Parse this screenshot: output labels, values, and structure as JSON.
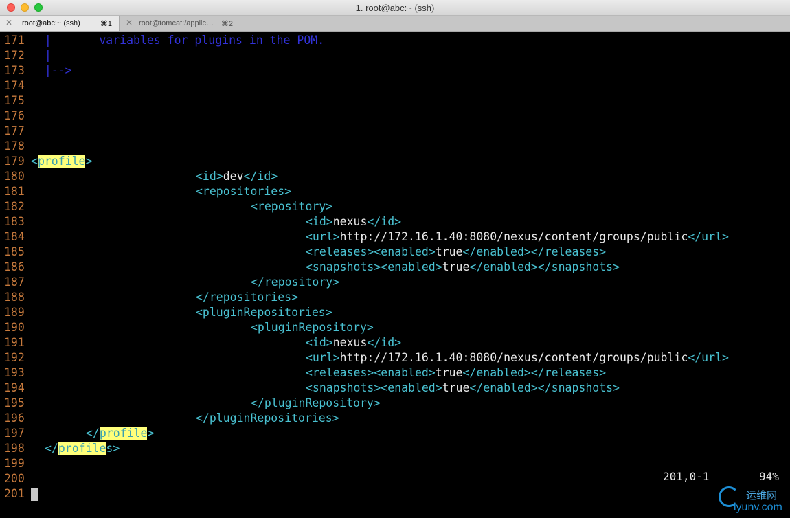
{
  "window": {
    "title": "1. root@abc:~ (ssh)"
  },
  "tabs": [
    {
      "label": "root@abc:~ (ssh)",
      "shortcut": "⌘1"
    },
    {
      "label": "root@tomcat:/applic…",
      "shortcut": "⌘2"
    }
  ],
  "lines": [
    {
      "n": "171",
      "indent": 0,
      "segments": [
        {
          "t": "  |       variables for plugins in the POM.",
          "c": "comment"
        }
      ]
    },
    {
      "n": "172",
      "indent": 0,
      "segments": [
        {
          "t": "  |",
          "c": "comment"
        }
      ]
    },
    {
      "n": "173",
      "indent": 0,
      "segments": [
        {
          "t": "  |-->",
          "c": "comment"
        }
      ]
    },
    {
      "n": "174",
      "indent": 0,
      "segments": []
    },
    {
      "n": "175",
      "indent": 0,
      "segments": []
    },
    {
      "n": "176",
      "indent": 0,
      "segments": []
    },
    {
      "n": "177",
      "indent": 0,
      "segments": []
    },
    {
      "n": "178",
      "indent": 0,
      "segments": []
    },
    {
      "n": "179",
      "indent": 0,
      "segments": [
        {
          "t": "<",
          "c": "tag"
        },
        {
          "t": "profile",
          "c": "hl"
        },
        {
          "t": ">",
          "c": "tag"
        }
      ]
    },
    {
      "n": "180",
      "indent": 24,
      "segments": [
        {
          "t": "<id>",
          "c": "tag"
        },
        {
          "t": "dev",
          "c": "txt"
        },
        {
          "t": "</id>",
          "c": "tag"
        }
      ]
    },
    {
      "n": "181",
      "indent": 24,
      "segments": [
        {
          "t": "<repositories>",
          "c": "tag"
        }
      ]
    },
    {
      "n": "182",
      "indent": 32,
      "segments": [
        {
          "t": "<repository>",
          "c": "tag"
        }
      ]
    },
    {
      "n": "183",
      "indent": 40,
      "segments": [
        {
          "t": "<id>",
          "c": "tag"
        },
        {
          "t": "nexus",
          "c": "txt"
        },
        {
          "t": "</id>",
          "c": "tag"
        }
      ]
    },
    {
      "n": "184",
      "indent": 40,
      "segments": [
        {
          "t": "<url>",
          "c": "tag"
        },
        {
          "t": "http://172.16.1.40:8080/nexus/content/groups/public",
          "c": "txt"
        },
        {
          "t": "</url>",
          "c": "tag"
        }
      ]
    },
    {
      "n": "185",
      "indent": 40,
      "segments": [
        {
          "t": "<releases><enabled>",
          "c": "tag"
        },
        {
          "t": "true",
          "c": "txt"
        },
        {
          "t": "</enabled></releases>",
          "c": "tag"
        }
      ]
    },
    {
      "n": "186",
      "indent": 40,
      "segments": [
        {
          "t": "<snapshots><enabled>",
          "c": "tag"
        },
        {
          "t": "true",
          "c": "txt"
        },
        {
          "t": "</enabled></snapshots>",
          "c": "tag"
        }
      ]
    },
    {
      "n": "187",
      "indent": 32,
      "segments": [
        {
          "t": "</repository>",
          "c": "tag"
        }
      ]
    },
    {
      "n": "188",
      "indent": 24,
      "segments": [
        {
          "t": "</repositories>",
          "c": "tag"
        }
      ]
    },
    {
      "n": "189",
      "indent": 24,
      "segments": [
        {
          "t": "<pluginRepositories>",
          "c": "tag"
        }
      ]
    },
    {
      "n": "190",
      "indent": 32,
      "segments": [
        {
          "t": "<pluginRepository>",
          "c": "tag"
        }
      ]
    },
    {
      "n": "191",
      "indent": 40,
      "segments": [
        {
          "t": "<id>",
          "c": "tag"
        },
        {
          "t": "nexus",
          "c": "txt"
        },
        {
          "t": "</id>",
          "c": "tag"
        }
      ]
    },
    {
      "n": "192",
      "indent": 40,
      "segments": [
        {
          "t": "<url>",
          "c": "tag"
        },
        {
          "t": "http://172.16.1.40:8080/nexus/content/groups/public",
          "c": "txt"
        },
        {
          "t": "</url>",
          "c": "tag"
        }
      ]
    },
    {
      "n": "193",
      "indent": 40,
      "segments": [
        {
          "t": "<releases><enabled>",
          "c": "tag"
        },
        {
          "t": "true",
          "c": "txt"
        },
        {
          "t": "</enabled></releases>",
          "c": "tag"
        }
      ]
    },
    {
      "n": "194",
      "indent": 40,
      "segments": [
        {
          "t": "<snapshots><enabled>",
          "c": "tag"
        },
        {
          "t": "true",
          "c": "txt"
        },
        {
          "t": "</enabled></snapshots>",
          "c": "tag"
        }
      ]
    },
    {
      "n": "195",
      "indent": 32,
      "segments": [
        {
          "t": "</pluginRepository>",
          "c": "tag"
        }
      ]
    },
    {
      "n": "196",
      "indent": 24,
      "segments": [
        {
          "t": "</pluginRepositories>",
          "c": "tag"
        }
      ]
    },
    {
      "n": "197",
      "indent": 8,
      "segments": [
        {
          "t": "</",
          "c": "tag"
        },
        {
          "t": "profile",
          "c": "hl"
        },
        {
          "t": ">",
          "c": "tag"
        }
      ]
    },
    {
      "n": "198",
      "indent": 2,
      "segments": [
        {
          "t": "</",
          "c": "tag"
        },
        {
          "t": "profile",
          "c": "hl"
        },
        {
          "t": "s>",
          "c": "tag"
        }
      ]
    },
    {
      "n": "199",
      "indent": 0,
      "segments": []
    },
    {
      "n": "200",
      "indent": 0,
      "segments": []
    },
    {
      "n": "201",
      "indent": 0,
      "segments": []
    }
  ],
  "status": {
    "position": "201,0-1",
    "percent": "94%"
  },
  "watermark": {
    "top": "运维网",
    "bottom": "iyunv.com"
  }
}
